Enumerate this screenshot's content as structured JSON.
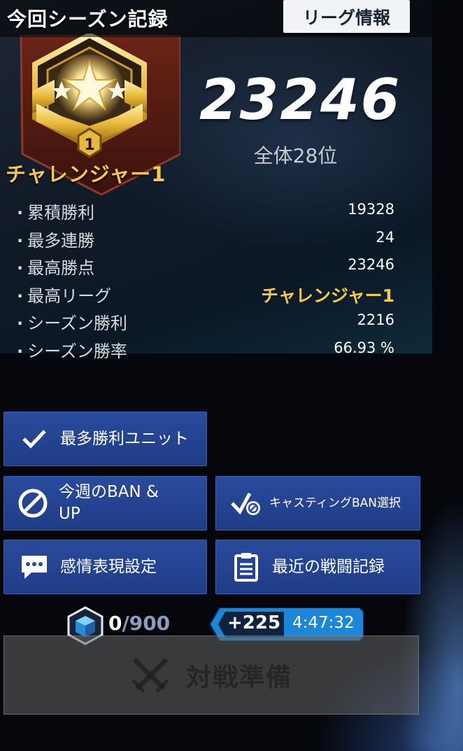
{
  "header": {
    "title": "今回シーズン記録",
    "league_info_label": "リーグ情報"
  },
  "rank": {
    "tier_number": "1",
    "name": "チャレンジャー1"
  },
  "score": {
    "value": "23246",
    "overall_rank": "全体28位"
  },
  "stats": [
    {
      "label": "累積勝利",
      "value": "19328"
    },
    {
      "label": "最多連勝",
      "value": "24"
    },
    {
      "label": "最高勝点",
      "value": "23246"
    },
    {
      "label": "最高リーグ",
      "value": "チャレンジャー1"
    },
    {
      "label": "シーズン勝利",
      "value": "2216"
    },
    {
      "label": "シーズン勝率",
      "value": "66.93 %"
    }
  ],
  "menu": {
    "most_wins_unit": "最多勝利ユニット",
    "weekly_ban_up": "今週のBAN &\nUP",
    "casting_ban": "キャスティングBAN選択",
    "emote_settings": "感情表現設定",
    "recent_battles": "最近の戦闘記録"
  },
  "resources": {
    "current": "0",
    "max": "/900",
    "bonus": "+225",
    "timer": "4:47:32"
  },
  "battle_prep_label": "対戦準備",
  "colors": {
    "gold": "#f5c84a",
    "button_blue": "#2a4a9c",
    "timer_blue": "#1c86d8"
  },
  "icons": [
    "check-icon",
    "ban-icon",
    "casting-ban-icon",
    "chat-bubble-icon",
    "clipboard-icon",
    "cube-resource-icon",
    "crossed-swords-icon"
  ]
}
